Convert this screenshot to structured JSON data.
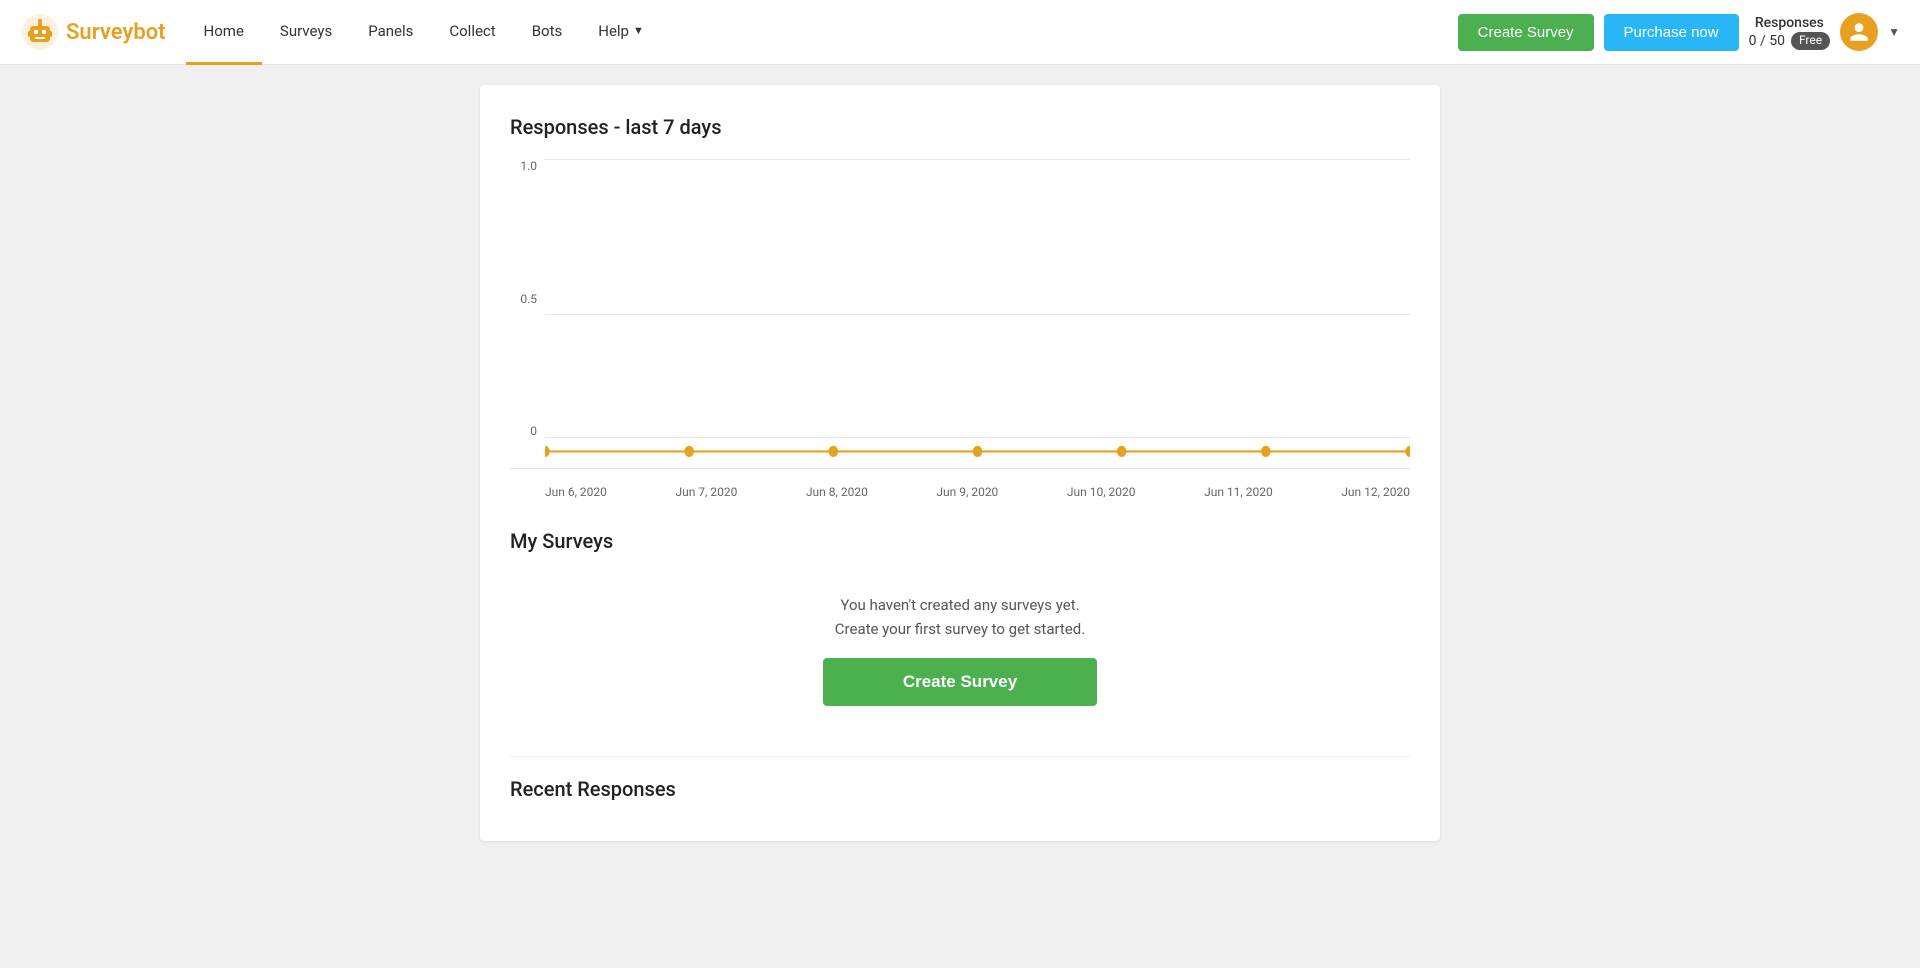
{
  "brand": {
    "name": "Surveybot"
  },
  "navbar": {
    "links": [
      {
        "label": "Home",
        "active": true
      },
      {
        "label": "Surveys",
        "active": false
      },
      {
        "label": "Panels",
        "active": false
      },
      {
        "label": "Collect",
        "active": false
      },
      {
        "label": "Bots",
        "active": false
      },
      {
        "label": "Help",
        "active": false
      }
    ],
    "create_survey_label": "Create Survey",
    "purchase_now_label": "Purchase now",
    "responses_label": "Responses",
    "responses_value": "0 / 50",
    "free_badge": "Free"
  },
  "chart": {
    "title": "Responses - last 7 days",
    "y_labels": [
      "1.0",
      "0.5",
      "0"
    ],
    "x_labels": [
      "Jun 6, 2020",
      "Jun 7, 2020",
      "Jun 8, 2020",
      "Jun 9, 2020",
      "Jun 10, 2020",
      "Jun 11, 2020",
      "Jun 12, 2020"
    ]
  },
  "my_surveys": {
    "title": "My Surveys",
    "empty_line1": "You haven't created any surveys yet.",
    "empty_line2": "Create your first survey to get started.",
    "create_button_label": "Create Survey"
  },
  "recent_responses": {
    "title": "Recent Responses"
  }
}
